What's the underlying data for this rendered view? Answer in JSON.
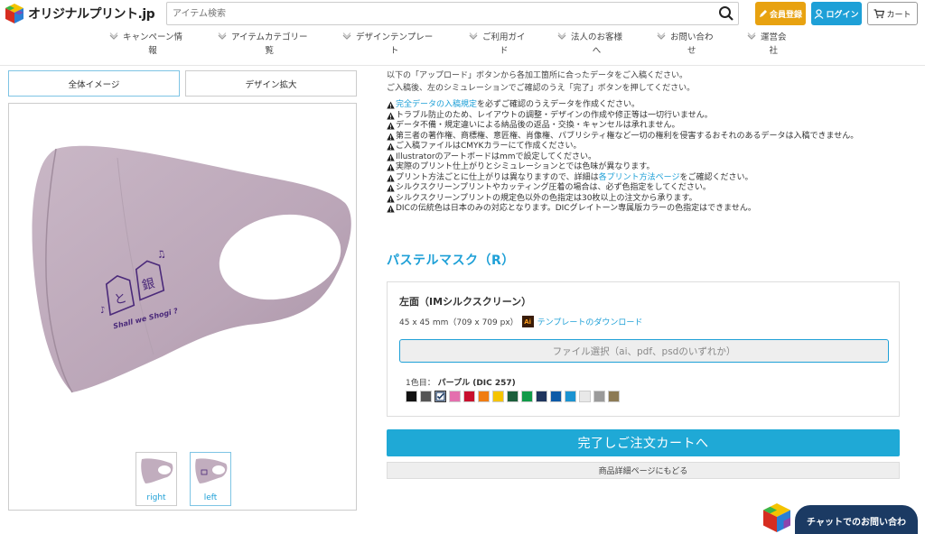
{
  "header": {
    "logo_text": "オリジナルプリント.jp",
    "search_placeholder": "アイテム検索",
    "member_label": "会員登録",
    "login_label": "ログイン",
    "cart_label": "カート"
  },
  "nav": {
    "items": [
      {
        "line1": "キャンペーン情",
        "line2": "報"
      },
      {
        "line1": "アイテムカテゴリー",
        "line2": "覧"
      },
      {
        "line1": "デザインテンプレー",
        "line2": "ト"
      },
      {
        "line1": "ご利用ガイ",
        "line2": "ド"
      },
      {
        "line1": "法人のお客様",
        "line2": "へ"
      },
      {
        "line1": "お問い合わ",
        "line2": "せ"
      },
      {
        "line1": "運営会",
        "line2": "社"
      }
    ]
  },
  "tabs": {
    "overall": "全体イメージ",
    "zoom": "デザイン拡大"
  },
  "thumbs": [
    {
      "label": "right"
    },
    {
      "label": "left"
    }
  ],
  "instructions": {
    "line1": "以下の「アップロード」ボタンから各加工箇所に合ったデータをご入稿ください。",
    "line2": "ご入稿後、左のシミュレーションでご確認のうえ「完了」ボタンを押してください。"
  },
  "notes": {
    "n1_link": "完全データの入稿規定",
    "n1_rest": "を必ずご確認のうえデータを作成ください。",
    "n2": "トラブル防止のため、レイアウトの調整・デザインの作成や修正等は一切行いません。",
    "n3": "データ不備・規定違いによる納品後の返品・交換・キャンセルは承れません。",
    "n4": "第三者の著作権、商標権、意匠権、肖像権、パブリシティ権など一切の権利を侵害するおそれのあるデータは入稿できません。",
    "n5": "ご入稿ファイルはCMYKカラーにて作成ください。",
    "n6": "Illustratorのアートボードはmmで設定してください。",
    "n7": "実際のプリント仕上がりとシミュレーションとでは色味が異なります。",
    "n8_pre": "プリント方法ごとに仕上がりは異なりますので、詳細は",
    "n8_link": "各プリント方法ページ",
    "n8_post": "をご確認ください。",
    "n9": "シルクスクリーンプリントやカッティング圧着の場合は、必ず色指定をしてください。",
    "n10": "シルクスクリーンプリントの規定色以外の色指定は30枚以上の注文から承ります。",
    "n11": "DICの伝統色は日本のみの対応となります。DICグレイトーン専属版カラーの色指定はできません。"
  },
  "product": {
    "title": "パステルマスク（R）",
    "face_title": "左面（IMシルクスクリーン）",
    "size_text": "45 x 45 mm（709 x 709 px）",
    "ai_label": "Ai",
    "template_link": "テンプレートのダウンロード",
    "file_button": "ファイル選択（ai、pdf、psdのいずれか）",
    "color_label": "1色目：",
    "color_value": "パープル (DIC 257)",
    "complete_button": "完了しご注文カートへ",
    "back_button": "商品詳細ページにもどる"
  },
  "mask_print": {
    "line": "Shall we Shogi ?",
    "piece1": "と",
    "piece2": "銀"
  },
  "swatches": [
    "#111111",
    "#555555",
    "#ffffff",
    "#e46fae",
    "#c8102e",
    "#f07c12",
    "#f5c400",
    "#1b5e3b",
    "#109a48",
    "#1f355e",
    "#0d5aa7",
    "#1b93d1",
    "#e8e8e8",
    "#9a9a9a",
    "#8c7a55"
  ],
  "selected_swatch": 2,
  "chat": {
    "label": "チャットでのお問い合わ"
  }
}
